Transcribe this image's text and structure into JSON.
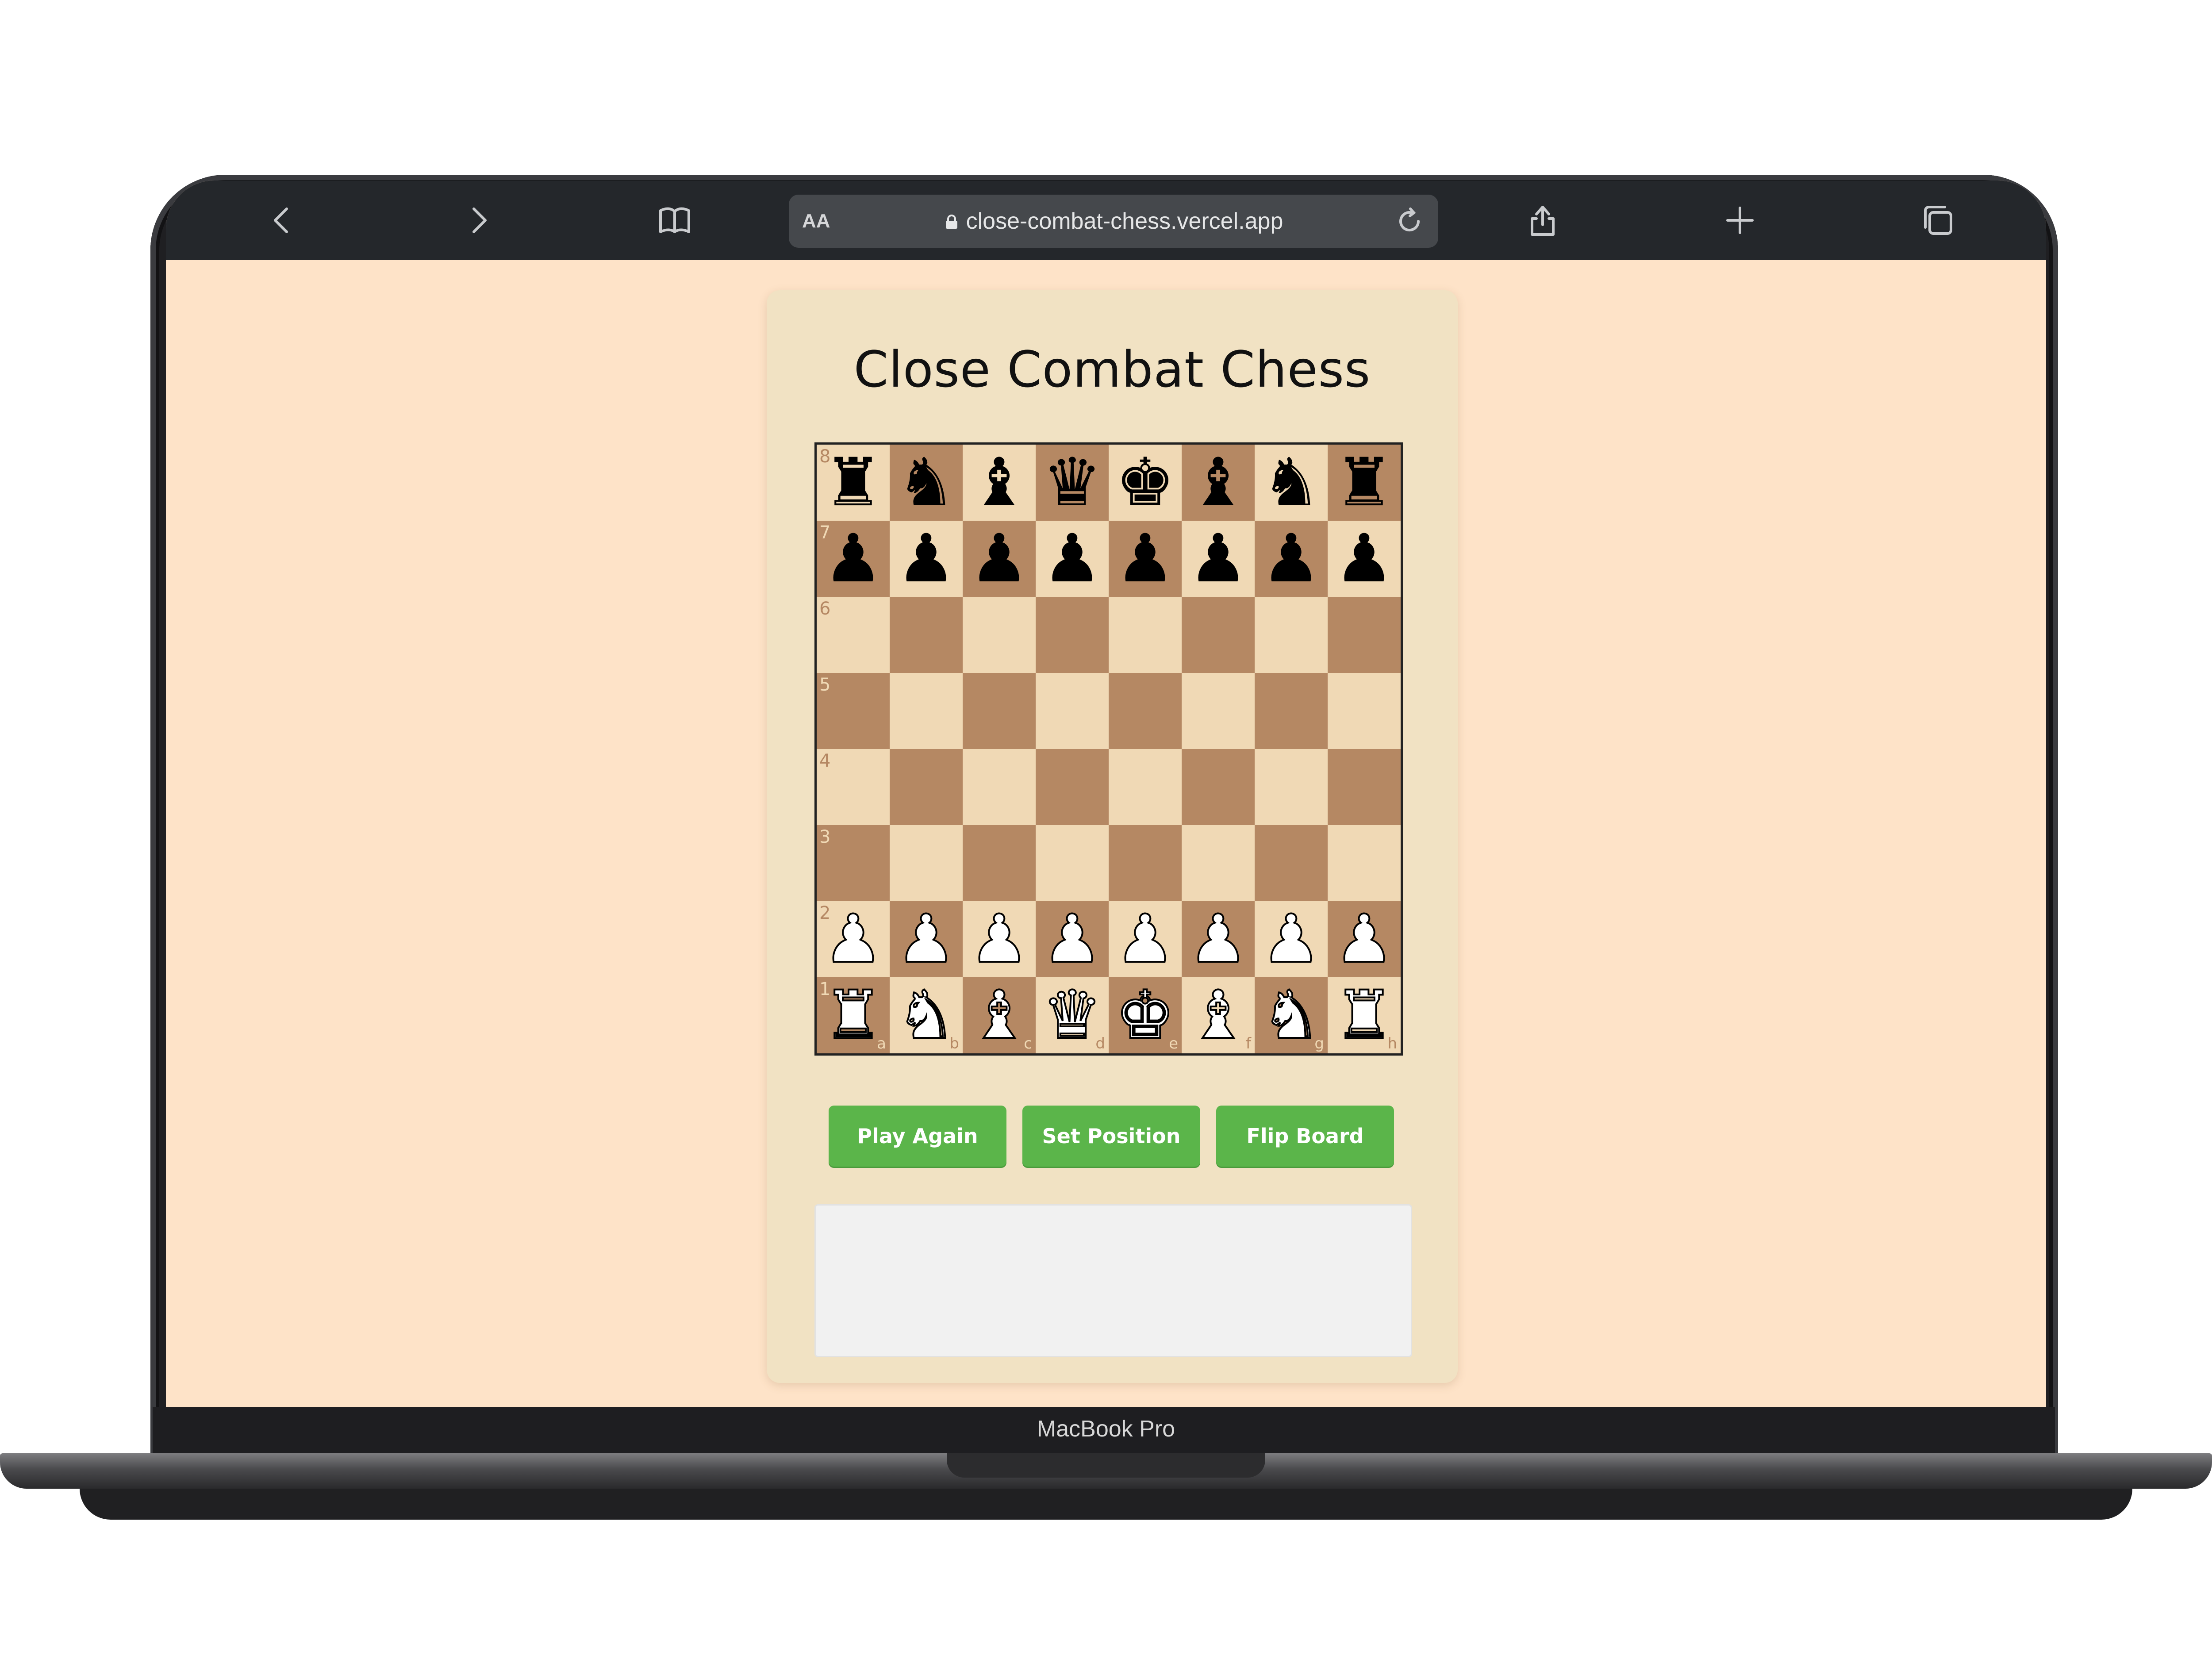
{
  "device": {
    "label": "MacBook Pro"
  },
  "browser": {
    "font_size_control": "AA",
    "url": "close-combat-chess.vercel.app",
    "icons": [
      "back-icon",
      "forward-icon",
      "bookmarks-icon",
      "lock-icon",
      "reload-icon",
      "share-icon",
      "new-tab-icon",
      "tabs-icon"
    ]
  },
  "app": {
    "title": "Close Combat Chess",
    "buttons": {
      "play_again": "Play Again",
      "set_position": "Set Position",
      "flip_board": "Flip Board"
    },
    "move_log": ""
  },
  "board": {
    "files": [
      "a",
      "b",
      "c",
      "d",
      "e",
      "f",
      "g",
      "h"
    ],
    "ranks": [
      "8",
      "7",
      "6",
      "5",
      "4",
      "3",
      "2",
      "1"
    ],
    "position": [
      [
        "br",
        "bn",
        "bb",
        "bq",
        "bk",
        "bb",
        "bn",
        "br"
      ],
      [
        "bp",
        "bp",
        "bp",
        "bp",
        "bp",
        "bp",
        "bp",
        "bp"
      ],
      [
        "",
        "",
        "",
        "",
        "",
        "",
        "",
        ""
      ],
      [
        "",
        "",
        "",
        "",
        "",
        "",
        "",
        ""
      ],
      [
        "",
        "",
        "",
        "",
        "",
        "",
        "",
        ""
      ],
      [
        "",
        "",
        "",
        "",
        "",
        "",
        "",
        ""
      ],
      [
        "wp",
        "wp",
        "wp",
        "wp",
        "wp",
        "wp",
        "wp",
        "wp"
      ],
      [
        "wr",
        "wn",
        "wb",
        "wq",
        "wk",
        "wb",
        "wn",
        "wr"
      ]
    ],
    "colors": {
      "light": "#f0d9b5",
      "dark": "#b58863"
    }
  },
  "colors": {
    "page_bg": "#fee3c8",
    "card_bg": "#f1e2c3",
    "button": "#5bb54a"
  }
}
